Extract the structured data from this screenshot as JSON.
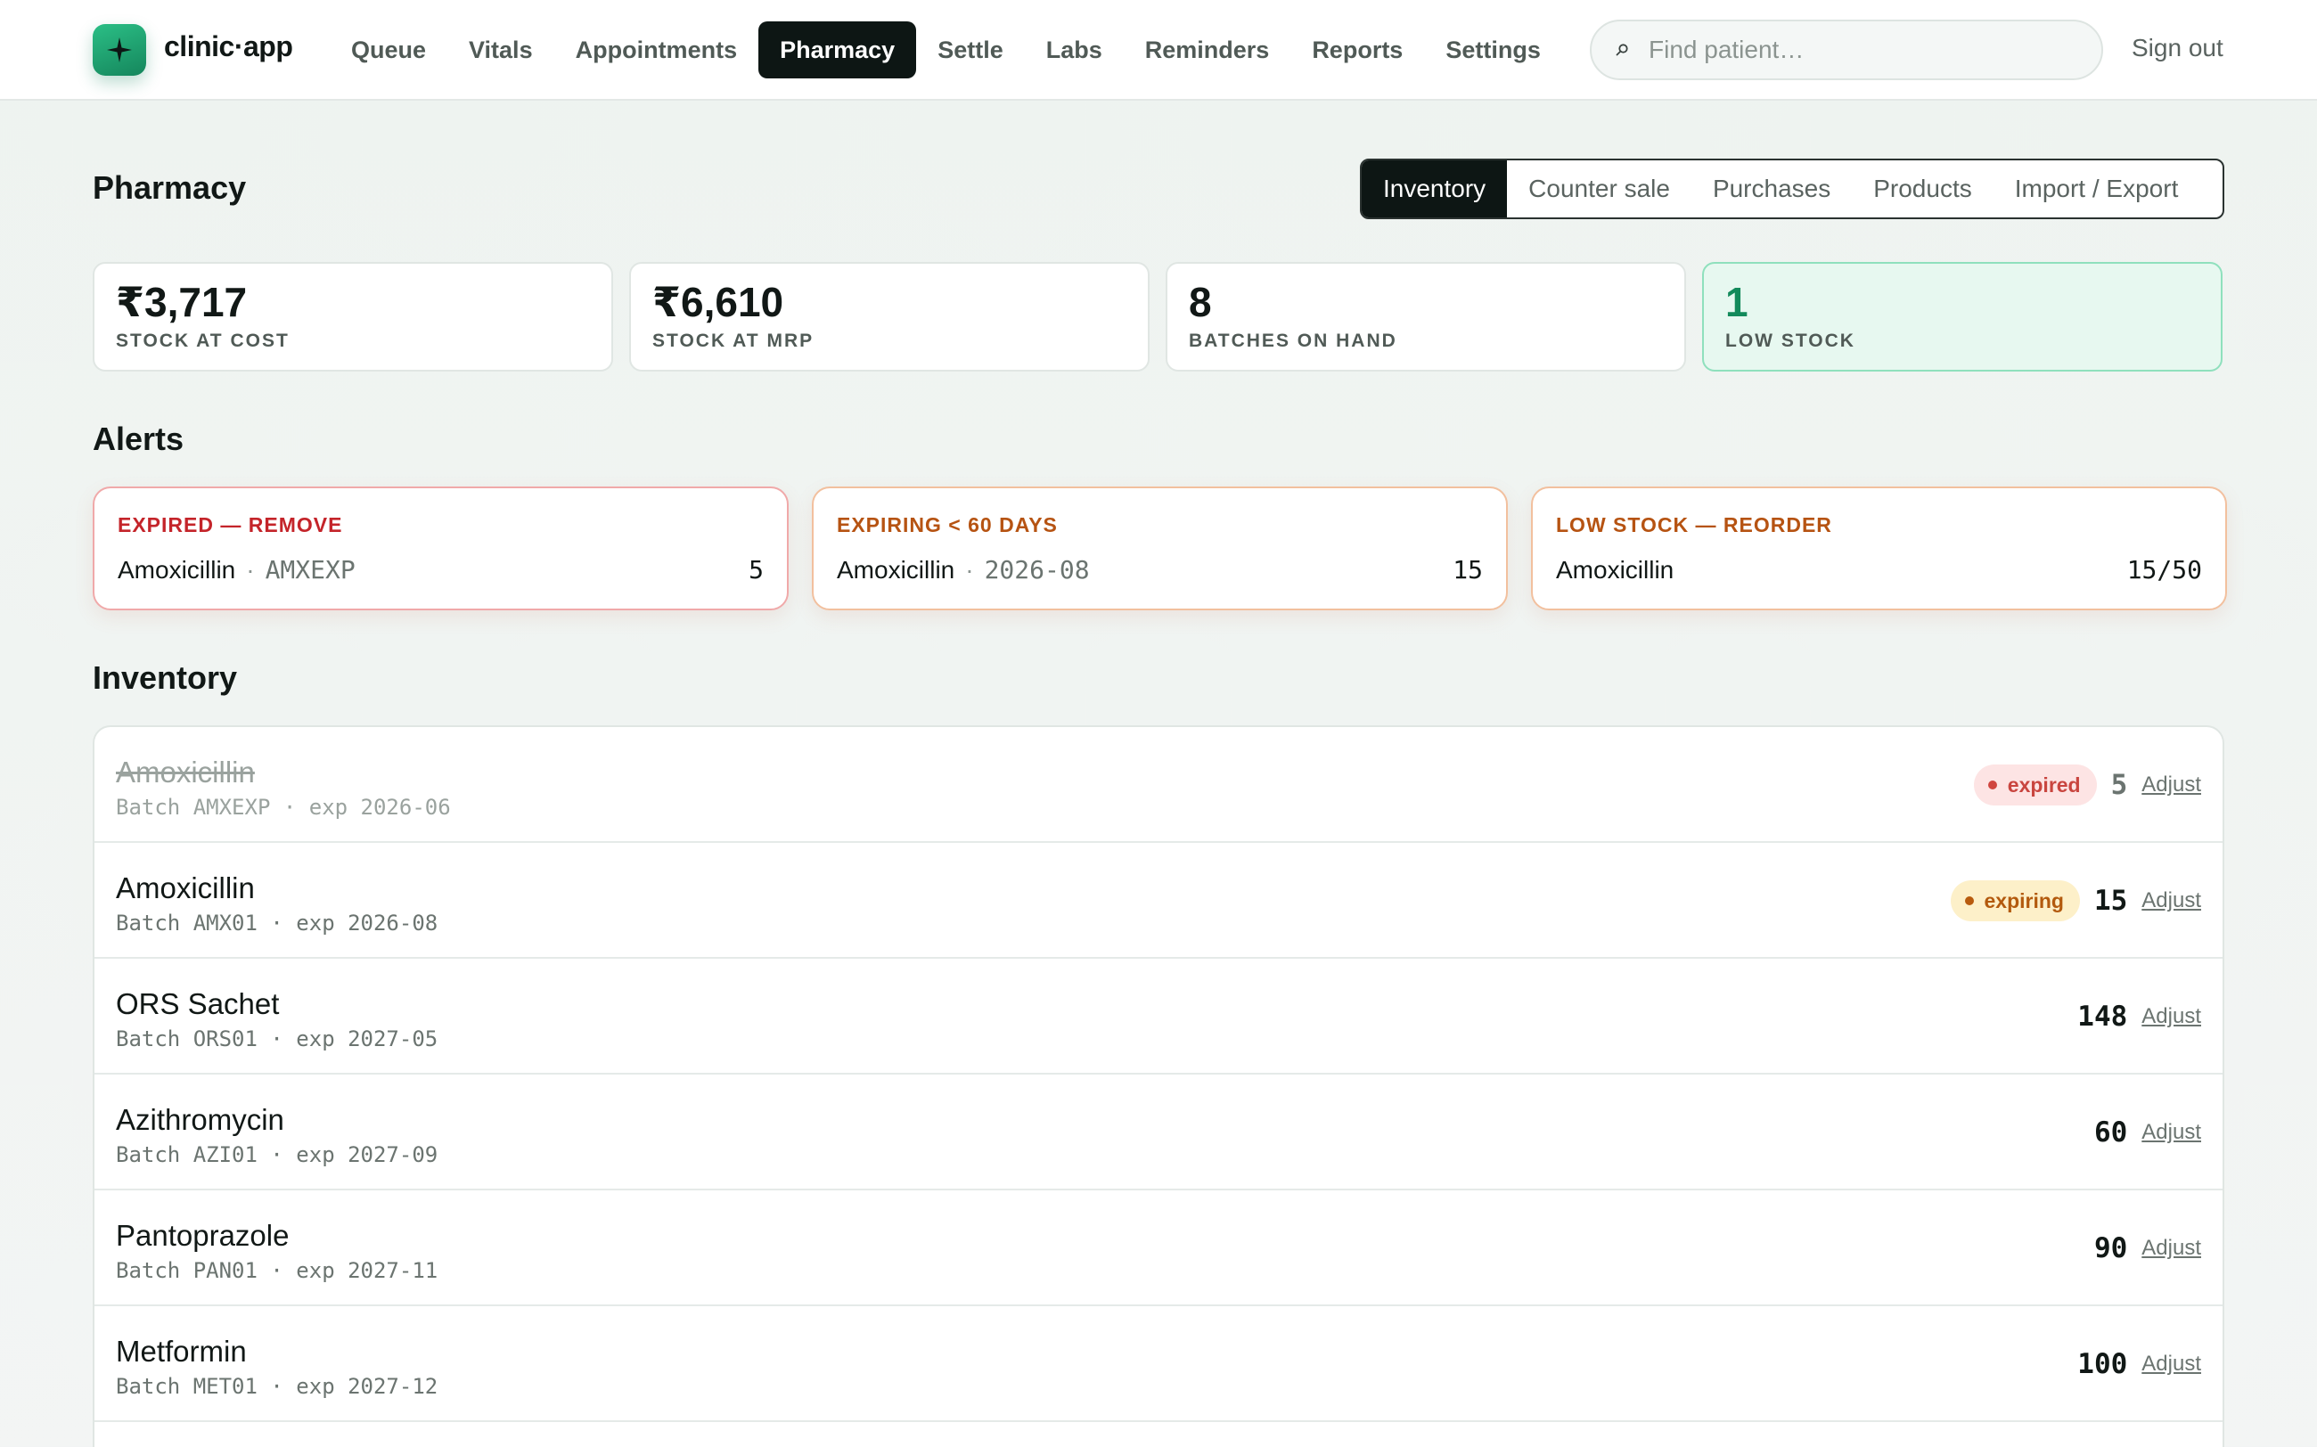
{
  "brand": {
    "name": "clinic·app",
    "logo_icon": "sparkle-icon",
    "accent": "#1fa874"
  },
  "nav": {
    "items": [
      "Queue",
      "Vitals",
      "Appointments",
      "Pharmacy",
      "Settle",
      "Labs",
      "Reminders",
      "Reports",
      "Settings"
    ],
    "active": "Pharmacy"
  },
  "search": {
    "placeholder": "Find patient…",
    "value": ""
  },
  "signout_label": "Sign out",
  "page": {
    "title": "Pharmacy",
    "tabs": [
      "Inventory",
      "Counter sale",
      "Purchases",
      "Products",
      "Import / Export"
    ],
    "active_tab": "Inventory"
  },
  "stats": [
    {
      "value": "₹3,717",
      "label": "STOCK AT COST"
    },
    {
      "value": "₹6,610",
      "label": "STOCK AT MRP"
    },
    {
      "value": "8",
      "label": "BATCHES ON HAND"
    },
    {
      "value": "1",
      "label": "LOW STOCK",
      "highlight": true
    }
  ],
  "alerts": {
    "title": "Alerts",
    "cards": [
      {
        "heading": "EXPIRED — REMOVE",
        "kind": "expired",
        "product": "Amoxicillin",
        "detail": "AMXEXP",
        "qty": "5"
      },
      {
        "heading": "EXPIRING < 60 DAYS",
        "kind": "expiring",
        "product": "Amoxicillin",
        "detail": "2026-08",
        "qty": "15"
      },
      {
        "heading": "LOW STOCK — REORDER",
        "kind": "low",
        "product": "Amoxicillin",
        "detail": "",
        "qty": "15/50"
      }
    ]
  },
  "inventory": {
    "title": "Inventory",
    "adjust_label": "Adjust",
    "rows": [
      {
        "name": "Amoxicillin",
        "meta": "Batch AMXEXP · exp 2026-06",
        "status": "expired",
        "status_label": "expired",
        "qty": "5"
      },
      {
        "name": "Amoxicillin",
        "meta": "Batch AMX01 · exp 2026-08",
        "status": "expiring",
        "status_label": "expiring",
        "qty": "15"
      },
      {
        "name": "ORS Sachet",
        "meta": "Batch ORS01 · exp 2027-05",
        "status": "",
        "status_label": "",
        "qty": "148"
      },
      {
        "name": "Azithromycin",
        "meta": "Batch AZI01 · exp 2027-09",
        "status": "",
        "status_label": "",
        "qty": "60"
      },
      {
        "name": "Pantoprazole",
        "meta": "Batch PAN01 · exp 2027-11",
        "status": "",
        "status_label": "",
        "qty": "90"
      },
      {
        "name": "Metformin",
        "meta": "Batch MET01 · exp 2027-12",
        "status": "",
        "status_label": "",
        "qty": "100"
      }
    ]
  }
}
